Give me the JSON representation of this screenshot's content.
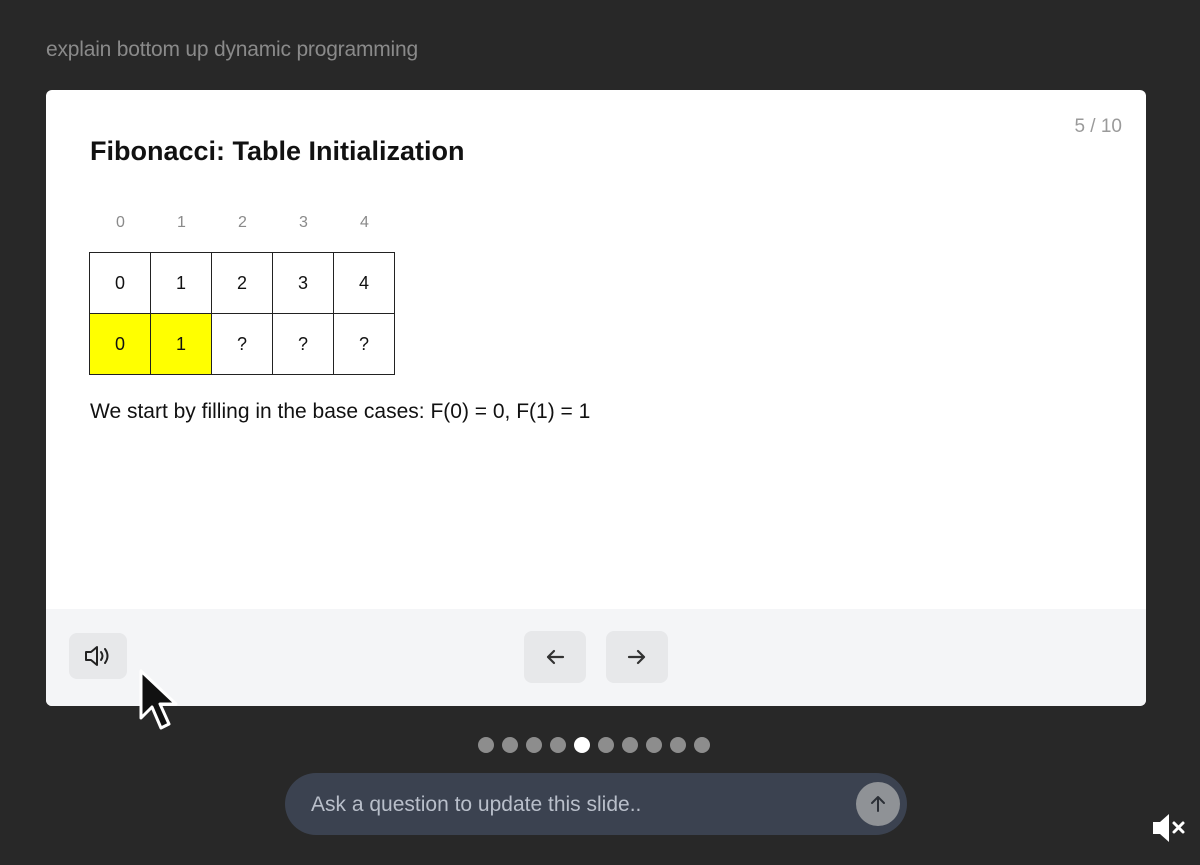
{
  "prompt": "explain bottom up dynamic programming",
  "slide": {
    "counter": "5 / 10",
    "title": "Fibonacci: Table Initialization",
    "indices": [
      "0",
      "1",
      "2",
      "3",
      "4"
    ],
    "row_n": [
      "0",
      "1",
      "2",
      "3",
      "4"
    ],
    "row_fib": [
      "0",
      "1",
      "?",
      "?",
      "?"
    ],
    "description": "We start by filling in the base cases: F(0) = 0, F(1) = 1",
    "highlight_color": "#ffff00"
  },
  "controls": {
    "audio_icon": "speaker-icon",
    "prev_icon": "arrow-left-icon",
    "next_icon": "arrow-right-icon"
  },
  "pagination": {
    "total": 10,
    "current": 5
  },
  "ask": {
    "placeholder": "Ask a question to update this slide..",
    "send_icon": "arrow-up-icon"
  },
  "overlay": {
    "mute_icon": "speaker-muted-icon"
  }
}
